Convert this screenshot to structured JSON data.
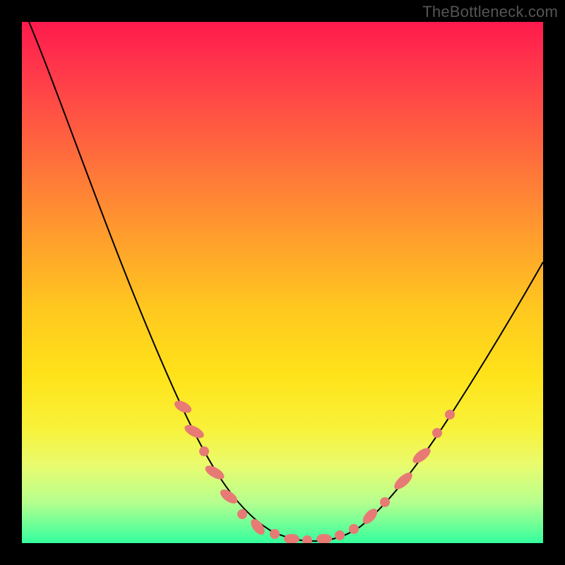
{
  "watermark": "TheBottleneck.com",
  "chart_data": {
    "type": "line",
    "title": "",
    "xlabel": "",
    "ylabel": "",
    "xlim": [
      0,
      100
    ],
    "ylim": [
      0,
      100
    ],
    "grid": false,
    "legend": false,
    "background_gradient": {
      "orientation": "vertical",
      "stops": [
        {
          "pos": 0,
          "color": "#ff1a4d",
          "meaning": "high-bottleneck"
        },
        {
          "pos": 50,
          "color": "#ffc81f"
        },
        {
          "pos": 100,
          "color": "#34ff9e",
          "meaning": "low-bottleneck"
        }
      ]
    },
    "series": [
      {
        "name": "bottleneck-curve",
        "x": [
          0,
          5,
          10,
          15,
          20,
          25,
          30,
          35,
          40,
          45,
          48,
          50,
          52,
          55,
          58,
          60,
          62,
          65,
          70,
          75,
          80,
          85,
          90,
          95,
          100
        ],
        "y": [
          100,
          92,
          83,
          73,
          63,
          52,
          41,
          30,
          19,
          9,
          4,
          1,
          0,
          0,
          0,
          1,
          3,
          6,
          12,
          19,
          26,
          33,
          41,
          48,
          55
        ]
      }
    ],
    "markers": {
      "name": "highlight-band",
      "x": [
        30,
        32,
        35,
        38,
        41,
        43,
        46,
        48,
        50,
        52,
        54,
        56,
        58,
        60,
        62,
        64,
        67,
        69
      ],
      "note": "salmon dots/segments along the curve near the trough region"
    }
  }
}
